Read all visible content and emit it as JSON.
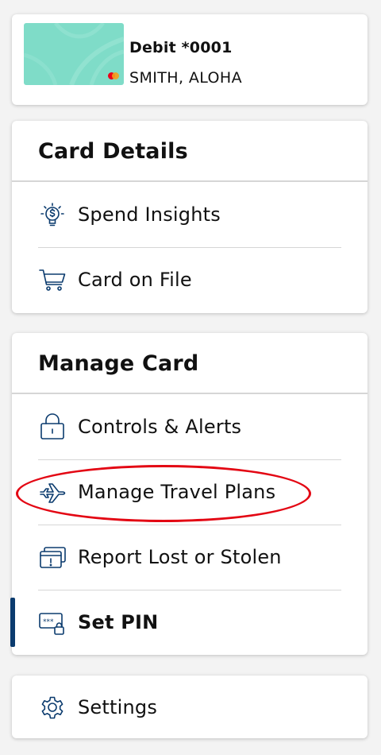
{
  "account": {
    "card_name": "Debit *0001",
    "card_holder": "SMITH, ALOHA",
    "card_network_icon": "mastercard-logo",
    "card_color": "#7fdcc8"
  },
  "card_details": {
    "title": "Card Details",
    "items": [
      {
        "label": "Spend Insights",
        "icon": "lightbulb-dollar-icon"
      },
      {
        "label": "Card on File",
        "icon": "shopping-cart-icon"
      }
    ]
  },
  "manage_card": {
    "title": "Manage Card",
    "items": [
      {
        "label": "Controls & Alerts",
        "icon": "lock-icon"
      },
      {
        "label": "Manage Travel Plans",
        "icon": "airplane-icon",
        "annotated": true
      },
      {
        "label": "Report Lost or Stolen",
        "icon": "card-alert-icon"
      },
      {
        "label": "Set PIN",
        "icon": "pin-lock-icon",
        "selected": true
      }
    ]
  },
  "settings": {
    "label": "Settings",
    "icon": "gear-icon"
  },
  "colors": {
    "icon": "#0b3b6e",
    "active_indicator": "#0b3b6e",
    "annotation": "#e30613",
    "background": "#f3f3f3"
  }
}
